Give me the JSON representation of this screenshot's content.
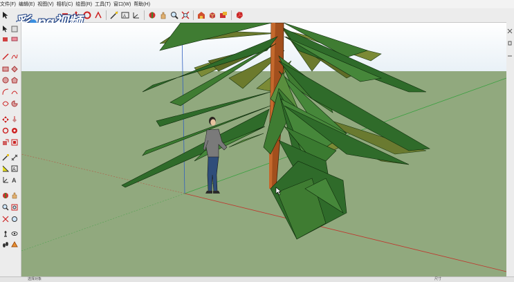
{
  "menu": {
    "items": [
      "文件(F)",
      "编辑(E)",
      "视图(V)",
      "相机(C)",
      "绘图(R)",
      "工具(T)",
      "窗口(W)",
      "帮助(H)"
    ]
  },
  "watermark": {
    "text_left": "彩",
    "text_mid": "ng",
    "text_right": "视频"
  },
  "toolbar": {
    "icons": [
      "select-icon",
      "eraser-icon",
      "paint-icon",
      "rotate-icon",
      "move-icon",
      "orbit-icon",
      "pan-icon",
      "zoom-icon",
      "zoom-extents-icon",
      "warehouse-icon",
      "components-icon",
      "extension-icon",
      "ruby-icon"
    ]
  },
  "status": {
    "left": "选择对象",
    "right": "尺寸"
  },
  "colors": {
    "sky": "#ffffff",
    "ground": "#91a97e",
    "leaf_dark": "#2f6b2a",
    "leaf_light": "#5a8f3e",
    "leaf_olive": "#6c7a2d",
    "trunk": "#a24f1d"
  }
}
